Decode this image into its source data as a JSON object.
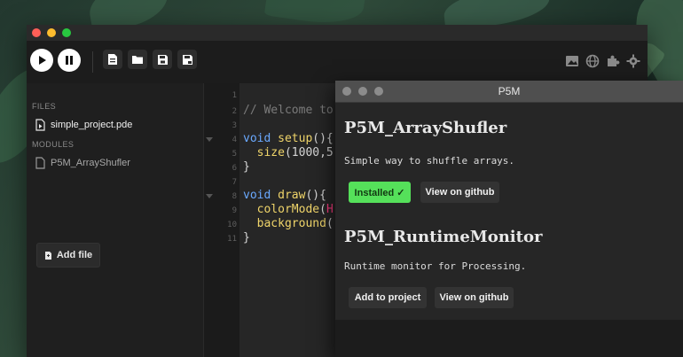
{
  "window": {
    "traffic_lights": {
      "close": "#ff5f57",
      "minimize": "#febc2e",
      "maximize": "#28c840"
    },
    "toolbar": {
      "run_icon": "play-icon",
      "pause_icon": "pause-icon",
      "file_actions": [
        "new-file-icon",
        "open-folder-icon",
        "save-icon",
        "save-as-icon"
      ],
      "right_icons": [
        "image-export-icon",
        "globe-icon",
        "puzzle-icon",
        "gear-icon"
      ]
    }
  },
  "sidebar": {
    "files_header": "FILES",
    "files": [
      {
        "name": "simple_project.pde",
        "icon": "file-play-icon"
      }
    ],
    "modules_header": "MODULES",
    "modules": [
      {
        "name": "P5M_ArrayShufler",
        "icon": "file-icon"
      }
    ],
    "add_file_label": "Add file"
  },
  "editor": {
    "line_numbers": [
      "1",
      "2",
      "3",
      "4",
      "5",
      "6",
      "7",
      "8",
      "9",
      "10",
      "11"
    ],
    "lines": {
      "l2_comment": "// Welcome to",
      "l4_kw": "void",
      "l4_fn": "setup",
      "l4_rest": "(){",
      "l5_fn": "size",
      "l5_rest": "(1000,5",
      "l6": "}",
      "l8_kw": "void",
      "l8_fn": "draw",
      "l8_rest": "(){",
      "l9_fn": "colorMode",
      "l9_paren": "(",
      "l9_arg": "H",
      "l10_fn": "background",
      "l10_rest": "(",
      "l11": "}"
    }
  },
  "p5m": {
    "title": "P5M",
    "modules": [
      {
        "name": "P5M_ArrayShufler",
        "description": "Simple way to shuffle arrays.",
        "primary_label": "Installed ✓",
        "github_label": "View on github"
      },
      {
        "name": "P5M_RuntimeMonitor",
        "description": "Runtime monitor for Processing.",
        "primary_label": "Add to project",
        "github_label": "View on github"
      }
    ]
  },
  "colors": {
    "installed_green": "#55e05a",
    "keyword_blue": "#6aa9ff",
    "function_yellow": "#f0d56a",
    "accent_pink": "#ff3b82"
  }
}
